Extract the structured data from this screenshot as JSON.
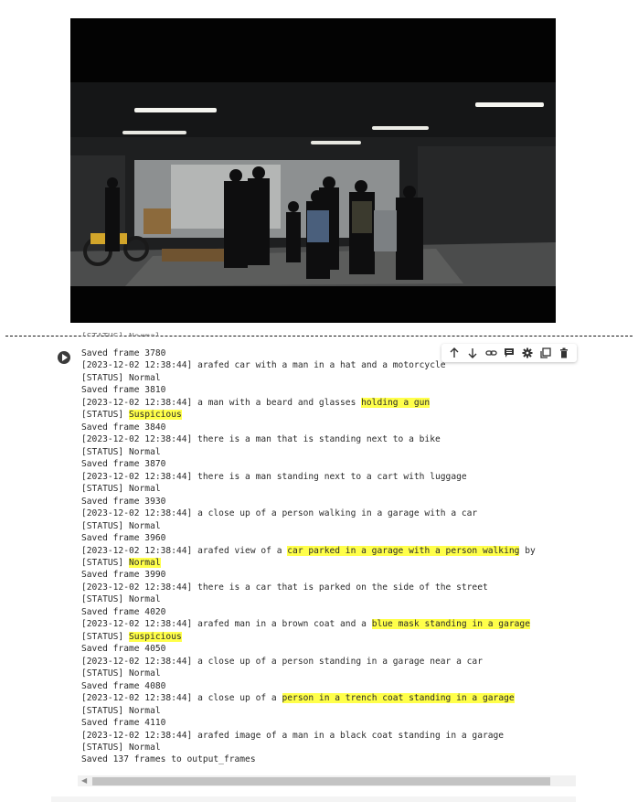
{
  "toolbar": {
    "icons": [
      "arrow-up-icon",
      "arrow-down-icon",
      "link-icon",
      "comment-icon",
      "gear-icon",
      "mirror-cell-icon",
      "trash-icon"
    ]
  },
  "output": {
    "truncated_top": "[STATUS] Normal",
    "lines": [
      {
        "segments": [
          {
            "text": "Saved frame 3780"
          }
        ]
      },
      {
        "segments": [
          {
            "text": "[2023-12-02 12:38:44] arafed car with a man in a hat and a motorcycle"
          }
        ]
      },
      {
        "segments": [
          {
            "text": "[STATUS] Normal"
          }
        ]
      },
      {
        "segments": [
          {
            "text": "Saved frame 3810"
          }
        ]
      },
      {
        "segments": [
          {
            "text": "[2023-12-02 12:38:44] a man with a beard and glasses "
          },
          {
            "text": "holding a gun",
            "hl": true
          }
        ]
      },
      {
        "segments": [
          {
            "text": "[STATUS] "
          },
          {
            "text": "Suspicious",
            "hl": true
          }
        ]
      },
      {
        "segments": [
          {
            "text": "Saved frame 3840"
          }
        ]
      },
      {
        "segments": [
          {
            "text": "[2023-12-02 12:38:44] there is a man that is standing next to a bike"
          }
        ]
      },
      {
        "segments": [
          {
            "text": "[STATUS] Normal"
          }
        ]
      },
      {
        "segments": [
          {
            "text": "Saved frame 3870"
          }
        ]
      },
      {
        "segments": [
          {
            "text": "[2023-12-02 12:38:44] there is a man standing next to a cart with luggage"
          }
        ]
      },
      {
        "segments": [
          {
            "text": "[STATUS] Normal"
          }
        ]
      },
      {
        "segments": [
          {
            "text": "Saved frame 3930"
          }
        ]
      },
      {
        "segments": [
          {
            "text": "[2023-12-02 12:38:44] a close up of a person walking in a garage with a car"
          }
        ]
      },
      {
        "segments": [
          {
            "text": "[STATUS] Normal"
          }
        ]
      },
      {
        "segments": [
          {
            "text": "Saved frame 3960"
          }
        ]
      },
      {
        "segments": [
          {
            "text": "[2023-12-02 12:38:44] arafed view of a "
          },
          {
            "text": "car parked in a garage with a person walking",
            "hl": true
          },
          {
            "text": " by"
          }
        ]
      },
      {
        "segments": [
          {
            "text": "[STATUS] "
          },
          {
            "text": "Normal",
            "hl": true
          }
        ]
      },
      {
        "segments": [
          {
            "text": "Saved frame 3990"
          }
        ]
      },
      {
        "segments": [
          {
            "text": "[2023-12-02 12:38:44] there is a car that is parked on the side of the street"
          }
        ]
      },
      {
        "segments": [
          {
            "text": "[STATUS] Normal"
          }
        ]
      },
      {
        "segments": [
          {
            "text": "Saved frame 4020"
          }
        ]
      },
      {
        "segments": [
          {
            "text": "[2023-12-02 12:38:44] arafed man in a brown coat and a "
          },
          {
            "text": "blue mask standing in a garage",
            "hl": true
          }
        ]
      },
      {
        "segments": [
          {
            "text": "[STATUS] "
          },
          {
            "text": "Suspicious",
            "hl": true
          }
        ]
      },
      {
        "segments": [
          {
            "text": "Saved frame 4050"
          }
        ]
      },
      {
        "segments": [
          {
            "text": "[2023-12-02 12:38:44] a close up of a person standing in a garage near a car"
          }
        ]
      },
      {
        "segments": [
          {
            "text": "[STATUS] Normal"
          }
        ]
      },
      {
        "segments": [
          {
            "text": "Saved frame 4080"
          }
        ]
      },
      {
        "segments": [
          {
            "text": "[2023-12-02 12:38:44] a close up of a "
          },
          {
            "text": "person in a trench coat standing in a garage",
            "hl": true
          }
        ]
      },
      {
        "segments": [
          {
            "text": "[STATUS] Normal"
          }
        ]
      },
      {
        "segments": [
          {
            "text": "Saved frame 4110"
          }
        ]
      },
      {
        "segments": [
          {
            "text": "[2023-12-02 12:38:44] arafed image of a man in a black coat standing in a garage"
          }
        ]
      },
      {
        "segments": [
          {
            "text": "[STATUS] Normal"
          }
        ]
      },
      {
        "segments": [
          {
            "text": "Saved 137 frames to output_frames"
          }
        ]
      }
    ]
  },
  "colors": {
    "highlight": "#ffff4a",
    "text": "#2a2a2a",
    "video_bg": "#040404"
  }
}
